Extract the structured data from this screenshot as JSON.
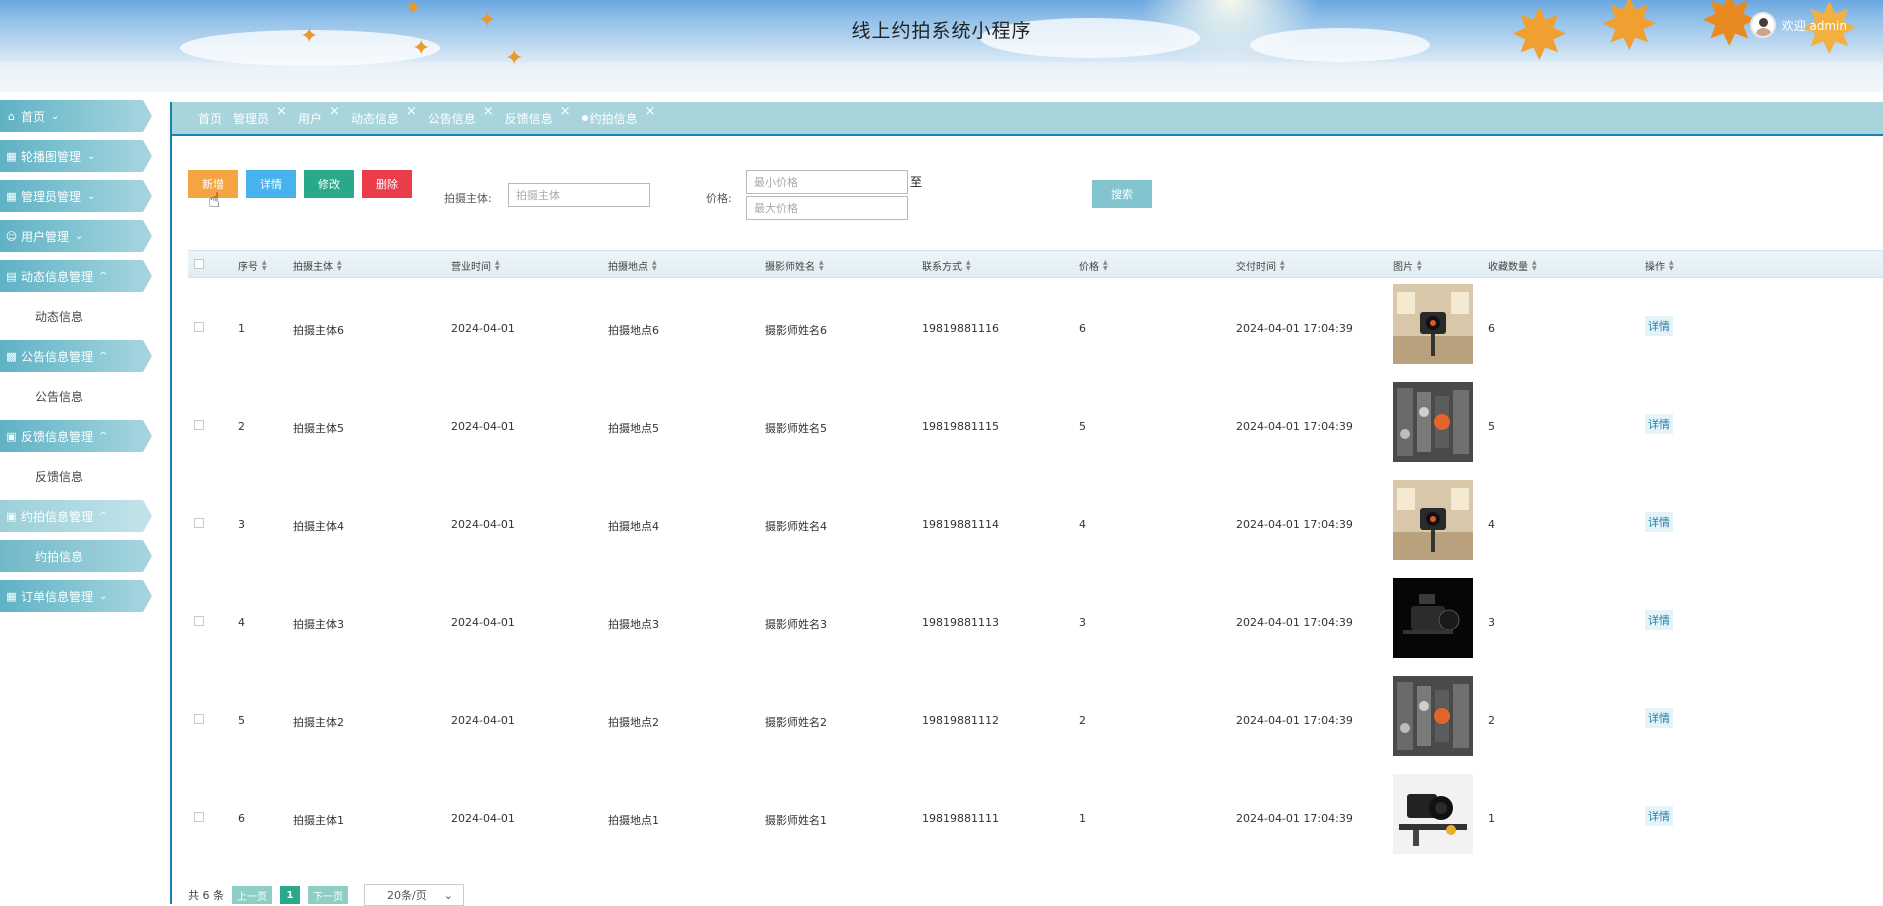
{
  "header": {
    "title": "线上约拍系统小程序",
    "user_label": "欢迎 admin"
  },
  "sidebar": {
    "items": [
      {
        "label": "首页",
        "icon": "home-icon",
        "chevron": "⌄"
      },
      {
        "label": "轮播图管理",
        "icon": "grid-icon",
        "chevron": "⌄"
      },
      {
        "label": "管理员管理",
        "icon": "grid-icon",
        "chevron": "⌄"
      },
      {
        "label": "用户管理",
        "icon": "user-icon",
        "chevron": "⌄"
      },
      {
        "label": "动态信息管理",
        "icon": "document-icon",
        "chevron": "^"
      },
      {
        "label": "动态信息"
      },
      {
        "label": "公告信息管理",
        "icon": "apps-icon",
        "chevron": "^"
      },
      {
        "label": "公告信息"
      },
      {
        "label": "反馈信息管理",
        "icon": "gift-icon",
        "chevron": "^"
      },
      {
        "label": "反馈信息"
      },
      {
        "label": "约拍信息管理",
        "icon": "gift-icon",
        "chevron": "^"
      },
      {
        "label": "约拍信息"
      },
      {
        "label": "订单信息管理",
        "icon": "grid-icon",
        "chevron": "⌄"
      }
    ]
  },
  "tabs": [
    {
      "label": "首页"
    },
    {
      "label": "管理员"
    },
    {
      "label": "用户"
    },
    {
      "label": "动态信息"
    },
    {
      "label": "公告信息"
    },
    {
      "label": "反馈信息"
    },
    {
      "label": "约拍信息"
    }
  ],
  "tab_close": "×",
  "toolbar": {
    "add": "新增",
    "detail": "详情",
    "edit": "修改",
    "delete": "删除",
    "subject_label": "拍摄主体:",
    "subject_placeholder": "拍摄主体",
    "price_label": "价格:",
    "min_placeholder": "最小价格",
    "max_placeholder": "最大价格",
    "to": "至",
    "search": "搜索"
  },
  "table": {
    "columns": [
      "序号",
      "拍摄主体",
      "营业时间",
      "拍摄地点",
      "摄影师姓名",
      "联系方式",
      "价格",
      "交付时间",
      "图片",
      "收藏数量",
      "操作"
    ],
    "rows": [
      {
        "no": "1",
        "subject": "拍摄主体6",
        "hours": "2024-04-01",
        "place": "拍摄地点6",
        "photographer": "摄影师姓名6",
        "phone": "19819881116",
        "price": "6",
        "delivery": "2024-04-01 17:04:39",
        "image": "studio-camera",
        "favorites": "6",
        "action": "详情"
      },
      {
        "no": "2",
        "subject": "拍摄主体5",
        "hours": "2024-04-01",
        "place": "拍摄地点5",
        "photographer": "摄影师姓名5",
        "phone": "19819881115",
        "price": "5",
        "delivery": "2024-04-01 17:04:39",
        "image": "camera-gear",
        "favorites": "5",
        "action": "详情"
      },
      {
        "no": "3",
        "subject": "拍摄主体4",
        "hours": "2024-04-01",
        "place": "拍摄地点4",
        "photographer": "摄影师姓名4",
        "phone": "19819881114",
        "price": "4",
        "delivery": "2024-04-01 17:04:39",
        "image": "studio-camera",
        "favorites": "4",
        "action": "详情"
      },
      {
        "no": "4",
        "subject": "拍摄主体3",
        "hours": "2024-04-01",
        "place": "拍摄地点3",
        "photographer": "摄影师姓名3",
        "phone": "19819881113",
        "price": "3",
        "delivery": "2024-04-01 17:04:39",
        "image": "cinema-camera-dark",
        "favorites": "3",
        "action": "详情"
      },
      {
        "no": "5",
        "subject": "拍摄主体2",
        "hours": "2024-04-01",
        "place": "拍摄地点2",
        "photographer": "摄影师姓名2",
        "phone": "19819881112",
        "price": "2",
        "delivery": "2024-04-01 17:04:39",
        "image": "camera-gear",
        "favorites": "2",
        "action": "详情"
      },
      {
        "no": "6",
        "subject": "拍摄主体1",
        "hours": "2024-04-01",
        "place": "拍摄地点1",
        "photographer": "摄影师姓名1",
        "phone": "19819881111",
        "price": "1",
        "delivery": "2024-04-01 17:04:39",
        "image": "camera-rig",
        "favorites": "1",
        "action": "详情"
      }
    ]
  },
  "pager": {
    "total": "共 6 条",
    "prev": "上一页",
    "page": "1",
    "next": "下一页",
    "size": "20条/页",
    "size_caret": "⌄"
  },
  "colors": {
    "accent": "#1f7fb0",
    "menu": "#6fbdcc",
    "add": "#f5a443",
    "detail": "#47b3ee",
    "edit": "#2aa98a",
    "delete": "#ea3d49"
  }
}
